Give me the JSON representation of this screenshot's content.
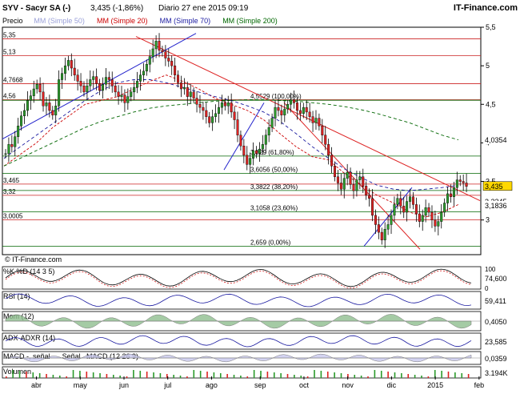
{
  "header": {
    "title": "SYV - Sacyr SA (-)",
    "quote": "3,435 (-1,86%)",
    "session": "Diario  27 ene 2015 09:19",
    "brand": "IT-Finance.com",
    "legend": [
      {
        "label": "Precio",
        "color": "#000000"
      },
      {
        "label": "MM (Simple 50)",
        "color": "#9aa0d8"
      },
      {
        "label": "MM (Simple 20)",
        "color": "#cc0000"
      },
      {
        "label": "MM (Simple 70)",
        "color": "#1a1aa0"
      },
      {
        "label": "MM (Simple 200)",
        "color": "#006600"
      }
    ]
  },
  "watermark": "IT-Finance.com",
  "chart_data": {
    "type": "candlestick",
    "price_axis": {
      "ylim": [
        2.55,
        5.5
      ],
      "ticks": [
        "5,5",
        "5",
        "4,5",
        "4",
        "3,5",
        "3"
      ],
      "tick_values": [
        5.5,
        5,
        4.5,
        4,
        3.5,
        3
      ]
    },
    "x_axis": {
      "labels": [
        "abr",
        "may",
        "jun",
        "jul",
        "ago",
        "sep",
        "oct",
        "nov",
        "dic",
        "2015",
        "feb"
      ],
      "label_positions": [
        0.07,
        0.16,
        0.25,
        0.34,
        0.43,
        0.53,
        0.62,
        0.71,
        0.8,
        0.89,
        0.98
      ]
    },
    "closes": [
      3.86,
      3.98,
      3.95,
      4.08,
      4.22,
      4.35,
      4.42,
      4.55,
      4.61,
      4.7,
      4.76,
      4.66,
      4.48,
      4.52,
      4.42,
      4.36,
      4.48,
      4.82,
      4.9,
      5.0,
      5.07,
      4.97,
      4.88,
      4.8,
      4.74,
      4.66,
      4.74,
      4.82,
      4.86,
      4.77,
      4.68,
      4.76,
      4.85,
      4.82,
      4.74,
      4.66,
      4.6,
      4.62,
      4.52,
      4.6,
      4.66,
      4.72,
      4.8,
      4.88,
      4.93,
      5.02,
      5.12,
      5.22,
      5.32,
      5.2,
      5.18,
      5.1,
      5.06,
      5.0,
      4.88,
      4.78,
      4.7,
      4.72,
      4.6,
      4.66,
      4.58,
      4.5,
      4.46,
      4.42,
      4.34,
      4.26,
      4.34,
      4.38,
      4.46,
      4.52,
      4.48,
      4.52,
      4.4,
      4.3,
      4.1,
      3.96,
      3.84,
      3.72,
      3.8,
      3.9,
      3.86,
      3.92,
      3.98,
      4.1,
      4.2,
      4.32,
      4.46,
      4.42,
      4.36,
      4.44,
      4.5,
      4.56,
      4.52,
      4.42,
      4.38,
      4.46,
      4.4,
      4.34,
      4.26,
      4.32,
      4.22,
      4.1,
      3.98,
      3.84,
      3.7,
      3.56,
      3.48,
      3.4,
      3.54,
      3.62,
      3.46,
      3.38,
      3.52,
      3.56,
      3.44,
      3.32,
      3.28,
      3.06,
      2.94,
      2.84,
      2.74,
      2.88,
      2.94,
      3.06,
      3.2,
      3.28,
      3.18,
      3.1,
      3.24,
      3.3,
      3.2,
      3.08,
      2.98,
      3.06,
      3.16,
      3.1,
      3.0,
      2.92,
      2.98,
      3.1,
      3.22,
      3.34,
      3.3,
      3.42,
      3.52,
      3.5,
      3.48,
      3.435
    ],
    "moving_averages": [
      {
        "name": "MM (Simple 20)",
        "color": "#cc0000",
        "values": [
          3.7,
          3.85,
          4.0,
          4.2,
          4.35,
          4.5,
          4.55,
          4.6,
          4.7,
          4.8,
          4.88,
          4.8,
          4.7,
          4.58,
          4.5,
          4.42,
          4.3,
          4.12,
          3.95,
          3.82,
          3.78,
          3.6,
          3.45,
          3.32,
          3.22,
          3.1,
          3.04,
          3.1,
          3.2
        ]
      },
      {
        "name": "MM (Simple 70)",
        "color": "#1a1aa0",
        "values": [
          3.8,
          3.95,
          4.1,
          4.25,
          4.4,
          4.55,
          4.68,
          4.78,
          4.82,
          4.82,
          4.78,
          4.72,
          4.66,
          4.6,
          4.55,
          4.48,
          4.4,
          4.28,
          4.12,
          3.95,
          3.8,
          3.66,
          3.55,
          3.45,
          3.4,
          3.38,
          3.4,
          3.42,
          3.45
        ]
      },
      {
        "name": "MM (Simple 200)",
        "color": "#006600",
        "values": [
          3.7,
          3.8,
          3.9,
          4.0,
          4.1,
          4.2,
          4.28,
          4.34,
          4.4,
          4.45,
          4.48,
          4.5,
          4.52,
          4.54,
          4.55,
          4.56,
          4.56,
          4.55,
          4.54,
          4.52,
          4.5,
          4.47,
          4.43,
          4.38,
          4.32,
          4.26,
          4.18,
          4.1,
          4.04
        ]
      }
    ],
    "fibonacci": [
      {
        "label": "4,5529 (100,00%)",
        "value": 4.5529
      },
      {
        "label": "3,829 (61,80%)",
        "value": 3.829
      },
      {
        "label": "3,6056 (50,00%)",
        "value": 3.6056
      },
      {
        "label": "3,3822 (38,20%)",
        "value": 3.3822
      },
      {
        "label": "3,1058 (23,60%)",
        "value": 3.1058
      },
      {
        "label": "2,659 (0,00%)",
        "value": 2.659
      }
    ],
    "left_levels": [
      "5,35",
      "5,13",
      "4,7668",
      "4,56",
      "3,465",
      "3,32",
      "3,0005"
    ],
    "left_level_values": [
      5.35,
      5.13,
      4.7668,
      4.56,
      3.465,
      3.32,
      3.0005
    ],
    "right_badges": [
      {
        "label": "4,0354",
        "value": 4.0354,
        "bg": "#ffffff",
        "fg": "#000000"
      },
      {
        "label": "3,435",
        "value": 3.435,
        "bg": "#ffd800",
        "fg": "#000000"
      },
      {
        "label": "3,2345",
        "value": 3.2345,
        "bg": "#ffffff",
        "fg": "#000000"
      },
      {
        "label": "3,1836",
        "value": 3.1836,
        "bg": "#ffffff",
        "fg": "#000000"
      }
    ],
    "panels": [
      {
        "name": "%K",
        "label": "%K",
        "label2": "%D (14 3 5)",
        "value": "74,600",
        "ticks": [
          "100",
          "0"
        ],
        "color": "#000000"
      },
      {
        "name": "RSI",
        "label": "RSI (14)",
        "value": "59,411",
        "ticks": [],
        "color": "#000000"
      },
      {
        "name": "Mom",
        "label": "Mom (12)",
        "value": "0,4050",
        "ticks": [],
        "color": "#000000"
      },
      {
        "name": "ADX",
        "label": "ADX",
        "label2": "ADXR (14)",
        "value": "23,585",
        "ticks": [],
        "color": "#000000"
      },
      {
        "name": "MACD",
        "label": "MACD -, señal",
        "label2": "Señal",
        "label3": "MACD (12 26 9)",
        "value": "0,0359",
        "ticks": [],
        "color": "#000000"
      },
      {
        "name": "Volumen",
        "label": "Volumen",
        "value": "3.194K",
        "ticks": [],
        "color": "#000000"
      }
    ]
  }
}
